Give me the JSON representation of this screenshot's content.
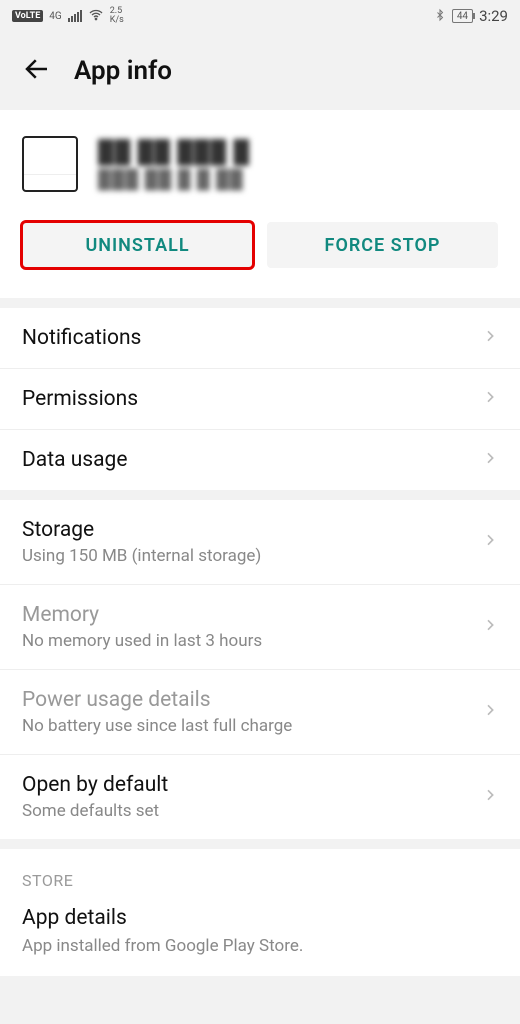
{
  "status": {
    "volte": "VoLTE",
    "net": "4G",
    "speed_top": "2.5",
    "speed_bot": "K/s",
    "battery": "44",
    "time": "3:29"
  },
  "header": {
    "title": "App info"
  },
  "app": {
    "name_masked": "██ ██ ███ █",
    "version_masked": "███ ██  █ █ ██"
  },
  "actions": {
    "uninstall": "UNINSTALL",
    "forcestop": "FORCE STOP"
  },
  "rows": {
    "notifications": {
      "title": "Notifications"
    },
    "permissions": {
      "title": "Permissions"
    },
    "datausage": {
      "title": "Data usage"
    },
    "storage": {
      "title": "Storage",
      "sub": "Using 150 MB (internal storage)"
    },
    "memory": {
      "title": "Memory",
      "sub": "No memory used in last 3 hours"
    },
    "power": {
      "title": "Power usage details",
      "sub": "No battery use since last full charge"
    },
    "openby": {
      "title": "Open by default",
      "sub": "Some defaults set"
    }
  },
  "store": {
    "header": "STORE",
    "title": "App details",
    "sub": "App installed from Google Play Store."
  }
}
